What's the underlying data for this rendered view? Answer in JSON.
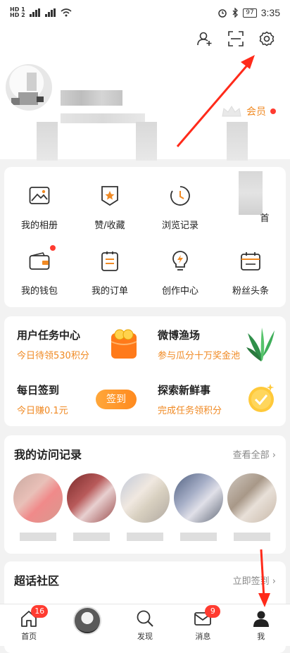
{
  "status_bar": {
    "sim1": "HD 1",
    "sim2": "HD 2",
    "net1": "4G",
    "net2": "4G",
    "battery": "97",
    "time": "3:35"
  },
  "header": {
    "top_icons": [
      "add-friend-icon",
      "scan-icon",
      "settings-gear-icon"
    ],
    "vip_label": "会员"
  },
  "grid": {
    "items": [
      {
        "label": "我的相册",
        "icon": "photo-album-icon"
      },
      {
        "label": "赞/收藏",
        "icon": "likes-collection-icon"
      },
      {
        "label": "浏览记录",
        "icon": "history-clock-icon"
      },
      {
        "label": "首",
        "icon": "blurred-icon"
      },
      {
        "label": "我的钱包",
        "icon": "wallet-icon"
      },
      {
        "label": "我的订单",
        "icon": "orders-icon"
      },
      {
        "label": "创作中心",
        "icon": "creator-bulb-icon"
      },
      {
        "label": "粉丝头条",
        "icon": "fans-headline-icon"
      }
    ]
  },
  "tasks": {
    "user_center": {
      "title": "用户任务中心",
      "sub": "今日待领530积分"
    },
    "weibo_fish": {
      "title": "微博渔场",
      "sub": "参与瓜分十万奖金池"
    },
    "daily_checkin": {
      "title": "每日签到",
      "sub": "今日赚0.1元",
      "button": "签到"
    },
    "explore": {
      "title": "探索新鲜事",
      "sub": "完成任务领积分"
    }
  },
  "visits": {
    "title": "我的访问记录",
    "more": "查看全部"
  },
  "topics": {
    "title": "超话社区",
    "more": "立即签到"
  },
  "tabbar": {
    "home": "首页",
    "home_badge": "16",
    "discover": "发现",
    "messages": "消息",
    "messages_badge": "9",
    "me": "我"
  },
  "colors": {
    "accent": "#f08a24",
    "badge": "#ff3b30",
    "annotation_arrow": "#ff2a1a"
  }
}
